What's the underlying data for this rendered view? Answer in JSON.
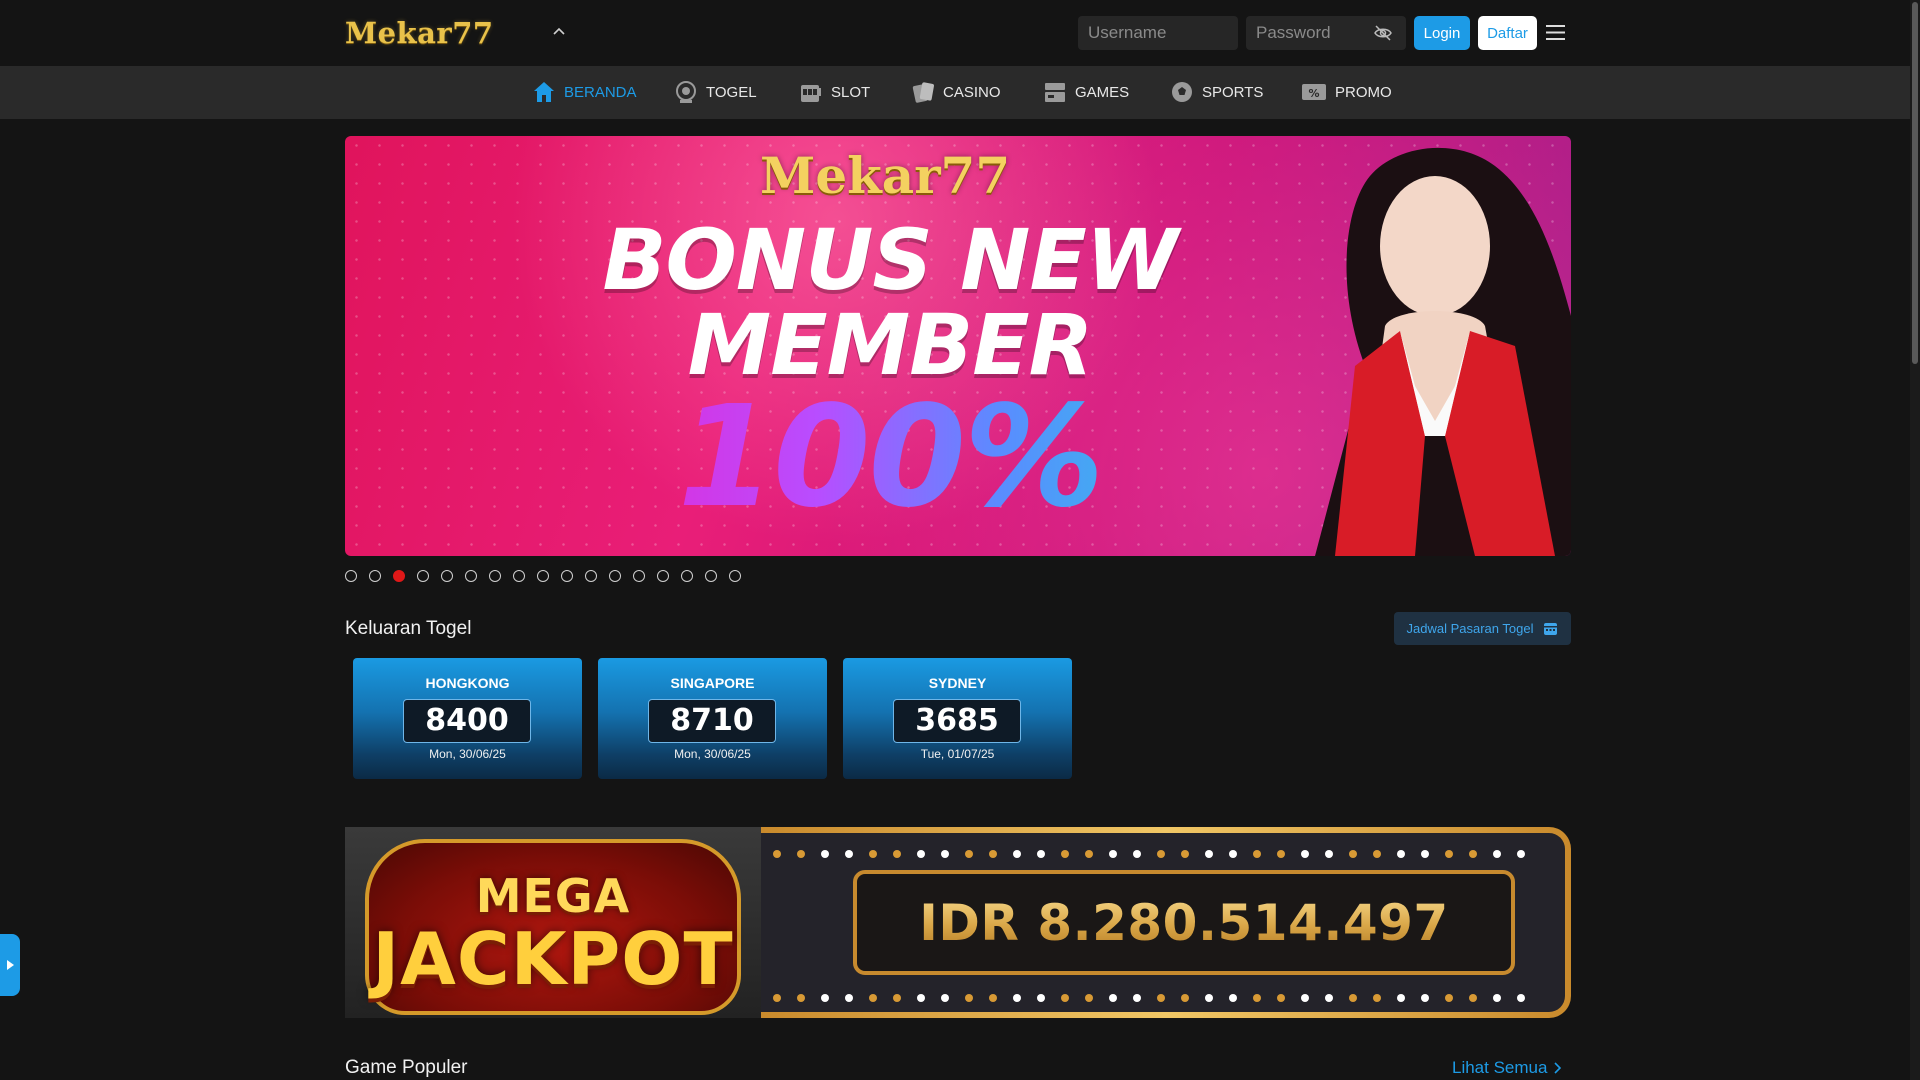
{
  "header": {
    "logo_text": "Mekar77",
    "username_placeholder": "Username",
    "password_placeholder": "Password",
    "login_label": "Login",
    "daftar_label": "Daftar"
  },
  "nav": [
    {
      "label": "BERANDA",
      "icon": "home-icon",
      "active": true
    },
    {
      "label": "TOGEL",
      "icon": "lottery-ball-icon",
      "active": false
    },
    {
      "label": "SLOT",
      "icon": "slot-machine-icon",
      "active": false
    },
    {
      "label": "CASINO",
      "icon": "cards-icon",
      "active": false
    },
    {
      "label": "GAMES",
      "icon": "arcade-icon",
      "active": false
    },
    {
      "label": "SPORTS",
      "icon": "soccer-ball-icon",
      "active": false
    },
    {
      "label": "PROMO",
      "icon": "percent-ticket-icon",
      "active": false
    }
  ],
  "banner": {
    "brand": "Mekar77",
    "line1": "BONUS NEW",
    "line2": "MEMBER",
    "line3": "100%",
    "slide_count": 17,
    "active_slide": 3
  },
  "togel": {
    "title": "Keluaran Togel",
    "schedule_button": "Jadwal Pasaran Togel",
    "results": [
      {
        "market": "HONGKONG",
        "number": "8400",
        "date": "Mon, 30/06/25"
      },
      {
        "market": "SINGAPORE",
        "number": "8710",
        "date": "Mon, 30/06/25"
      },
      {
        "market": "SYDNEY",
        "number": "3685",
        "date": "Tue, 01/07/25"
      }
    ]
  },
  "jackpot": {
    "title_line1": "MEGA",
    "title_line2": "JACKPOT",
    "value": "IDR 8.280.514.497"
  },
  "popular": {
    "title": "Game Populer",
    "see_all": "Lihat Semua"
  },
  "colors": {
    "accent": "#1d9be6",
    "active_dot": "#e01818",
    "gold": "#d9a647"
  }
}
